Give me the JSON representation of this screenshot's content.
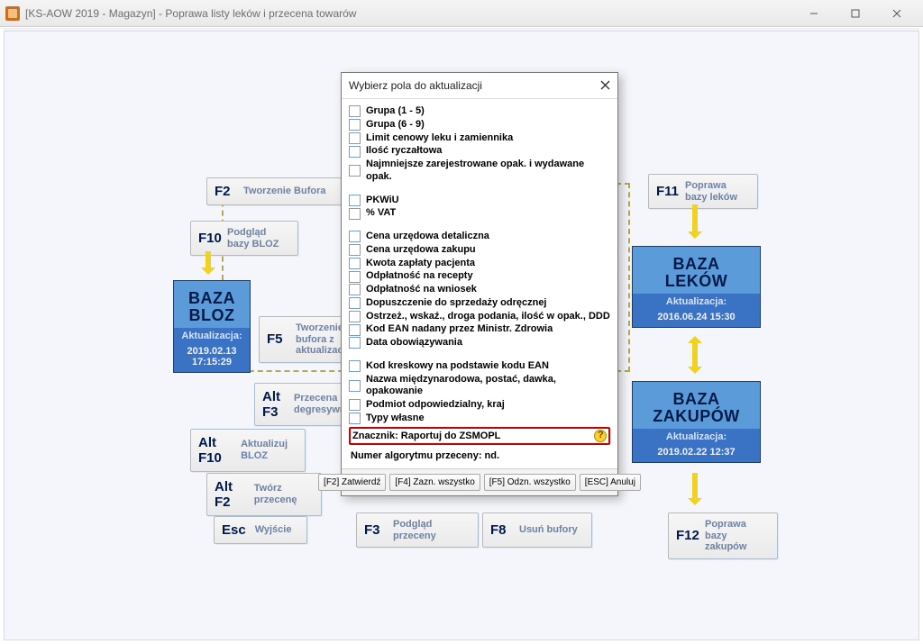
{
  "window": {
    "title": "[KS-AOW 2019 - Magazyn] - Poprawa listy leków i przecena towarów"
  },
  "shortcuts": {
    "f2": {
      "key": "F2",
      "label": "Tworzenie Bufora"
    },
    "f10": {
      "key": "F10",
      "label": "Podgląd bazy BLOZ"
    },
    "f5": {
      "key": "F5",
      "label": "Tworzenie bufora z aktualizacją"
    },
    "altf3": {
      "key": "Alt F3",
      "label": "Przecena degresywna"
    },
    "altf10": {
      "key": "Alt F10",
      "label": "Aktualizuj BLOZ"
    },
    "altf2": {
      "key": "Alt F2",
      "label": "Twórz przecenę"
    },
    "esc": {
      "key": "Esc",
      "label": "Wyjście"
    },
    "f3": {
      "key": "F3",
      "label": "Podgląd przeceny"
    },
    "f8": {
      "key": "F8",
      "label": "Usuń bufory"
    },
    "f11": {
      "key": "F11",
      "label": "Poprawa bazy leków"
    },
    "f12": {
      "key": "F12",
      "label": "Poprawa bazy zakupów"
    }
  },
  "nodes": {
    "bloz": {
      "title": "BAZA BLOZ",
      "sub": "Aktualizacja:",
      "date": "2019.02.13 17:15:29"
    },
    "lekow": {
      "title": "BAZA LEKÓW",
      "sub": "Aktualizacja:",
      "date": "2016.06.24 15:30"
    },
    "zakupow": {
      "title": "BAZA ZAKUPÓW",
      "sub": "Aktualizacja:",
      "date": "2019.02.22 12:37"
    }
  },
  "dialog": {
    "title": "Wybierz pola do aktualizacji",
    "groups": {
      "g1": "Grupa (1 - 5)",
      "g2": "Grupa (6 - 9)",
      "g3": "Limit cenowy leku i zamiennika",
      "g4": "Ilość ryczałtowa",
      "g5": "Najmniejsze zarejestrowane opak. i wydawane opak."
    },
    "tax": {
      "pkwiu": "PKWiU",
      "vat": "% VAT"
    },
    "prices": {
      "p1": "Cena urzędowa detaliczna",
      "p2": "Cena urzędowa zakupu",
      "p3": "Kwota zapłaty pacjenta",
      "p4": "Odpłatność na recepty",
      "p5": "Odpłatność na wniosek",
      "p6": "Dopuszczenie do sprzedaży odręcznej",
      "p7": "Ostrzeż., wskaź., droga podania, ilość w opak., DDD",
      "p8": "Kod EAN nadany przez Ministr. Zdrowia",
      "p9": "Data obowiązywania"
    },
    "misc": {
      "m1": "Kod kreskowy na podstawie kodu EAN",
      "m2": "Nazwa międzynarodowa, postać, dawka, opakowanie",
      "m3": "Podmiot odpowiedzialny, kraj",
      "m4": "Typy własne",
      "hl": "Znacznik: Raportuj do ZSMOPL"
    },
    "algo": "Numer algorytmu przeceny: nd.",
    "btns": {
      "confirm": "[F2] Zatwierdź",
      "checkall": "[F4] Zazn. wszystko",
      "uncheckall": "[F5] Odzn. wszystko",
      "cancel": "[ESC] Anuluj"
    }
  }
}
